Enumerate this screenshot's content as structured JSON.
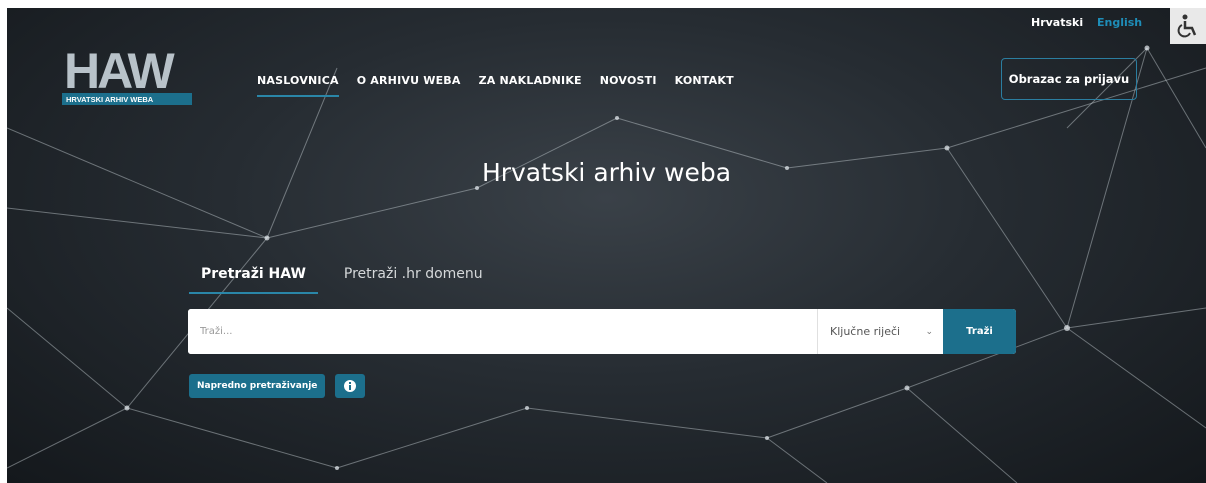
{
  "logo": {
    "text": "HAW",
    "subtitle": "HRVATSKI ARHIV WEBA"
  },
  "nav": [
    {
      "label": "NASLOVNICA"
    },
    {
      "label": "O ARHIVU WEBA"
    },
    {
      "label": "ZA NAKLADNIKE"
    },
    {
      "label": "NOVOSTI"
    },
    {
      "label": "KONTAKT"
    }
  ],
  "lang": {
    "current": "Hrvatski",
    "other": "English"
  },
  "register_button": "Obrazac za prijavu",
  "hero_title": "Hrvatski arhiv weba",
  "tabs": [
    {
      "label": "Pretraži HAW"
    },
    {
      "label": "Pretraži .hr domenu"
    }
  ],
  "search": {
    "placeholder": "Traži...",
    "select_value": "Ključne riječi",
    "button_label": "Traži"
  },
  "advanced_button": "Napredno pretraživanje",
  "colors": {
    "accent": "#1c6f8c",
    "link": "#1e8db8"
  },
  "icons": {
    "accessibility": "wheelchair-icon",
    "info": "info-icon",
    "dropdown": "chevron-down-icon"
  }
}
